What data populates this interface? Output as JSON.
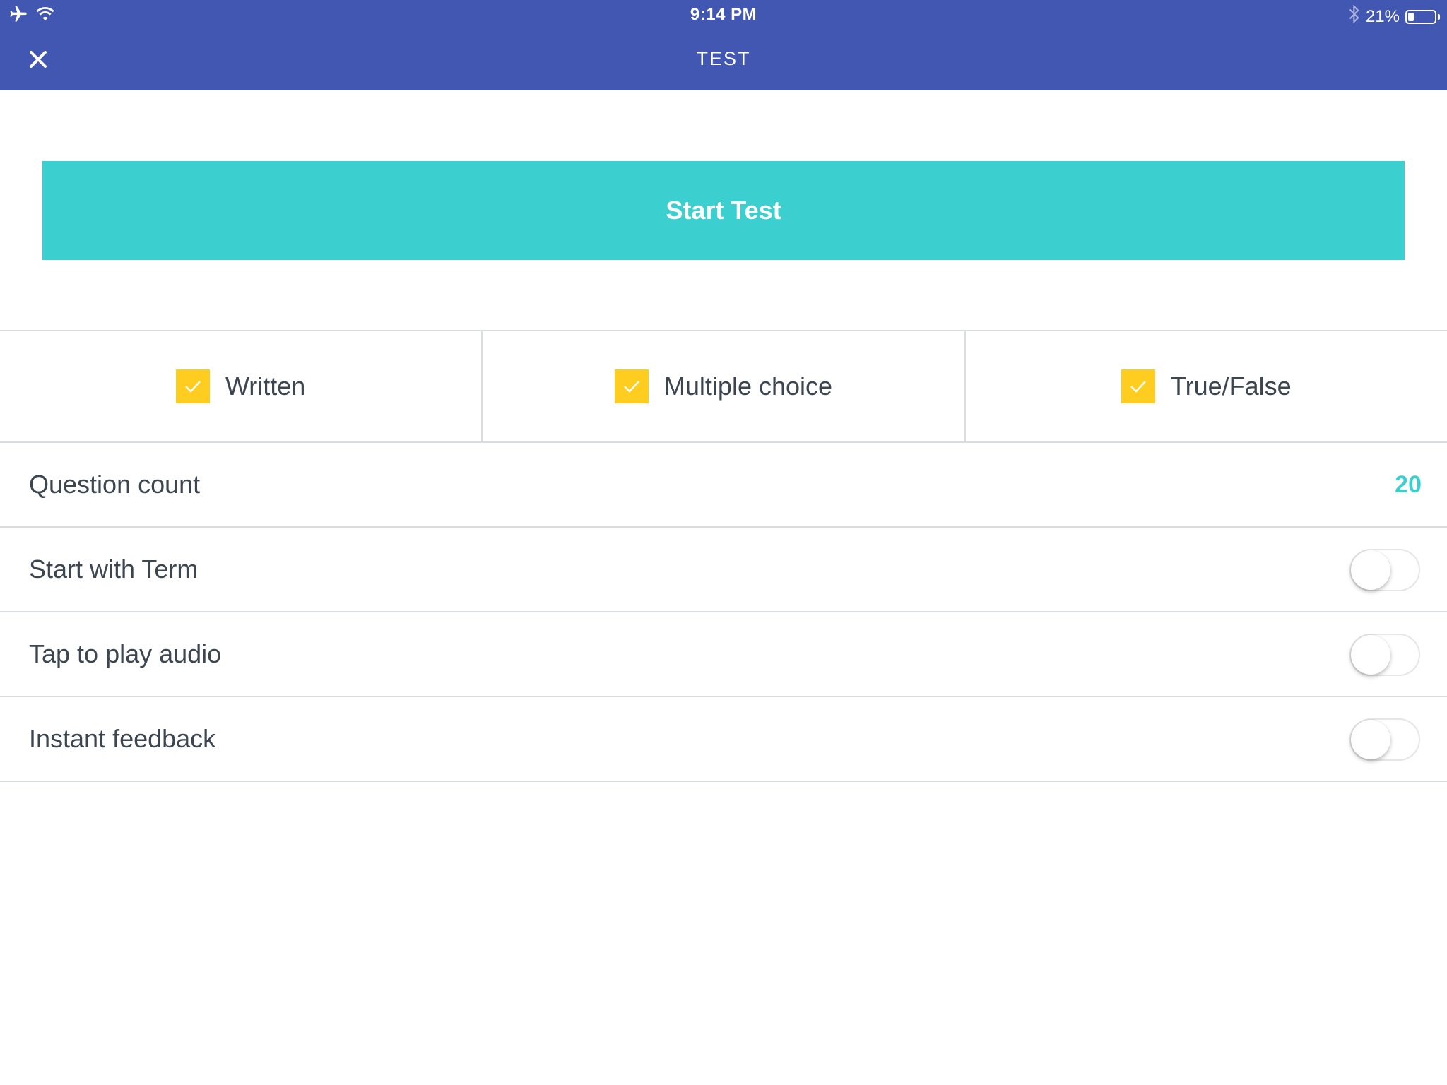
{
  "status_bar": {
    "time": "9:14 PM",
    "battery": "21%",
    "battery_level": 0.21,
    "icons": [
      "airplane-icon",
      "wifi-icon",
      "bluetooth-icon",
      "battery-icon"
    ]
  },
  "header": {
    "title": "TEST",
    "background_color": "#4257b2"
  },
  "start_button": {
    "label": "Start Test",
    "color": "#3ccfcf"
  },
  "question_types": [
    {
      "label": "Written",
      "checked": true
    },
    {
      "label": "Multiple choice",
      "checked": true
    },
    {
      "label": "True/False",
      "checked": true
    }
  ],
  "settings": {
    "question_count": {
      "label": "Question count",
      "value": "20"
    },
    "start_with_term": {
      "label": "Start with Term",
      "on": false
    },
    "tap_to_play_audio": {
      "label": "Tap to play audio",
      "on": false
    },
    "instant_feedback": {
      "label": "Instant feedback",
      "on": false
    }
  },
  "colors": {
    "accent": "#3ccfcf",
    "checkbox": "#ffcd1f",
    "text": "#3c4650",
    "divider": "#d9dde0"
  }
}
